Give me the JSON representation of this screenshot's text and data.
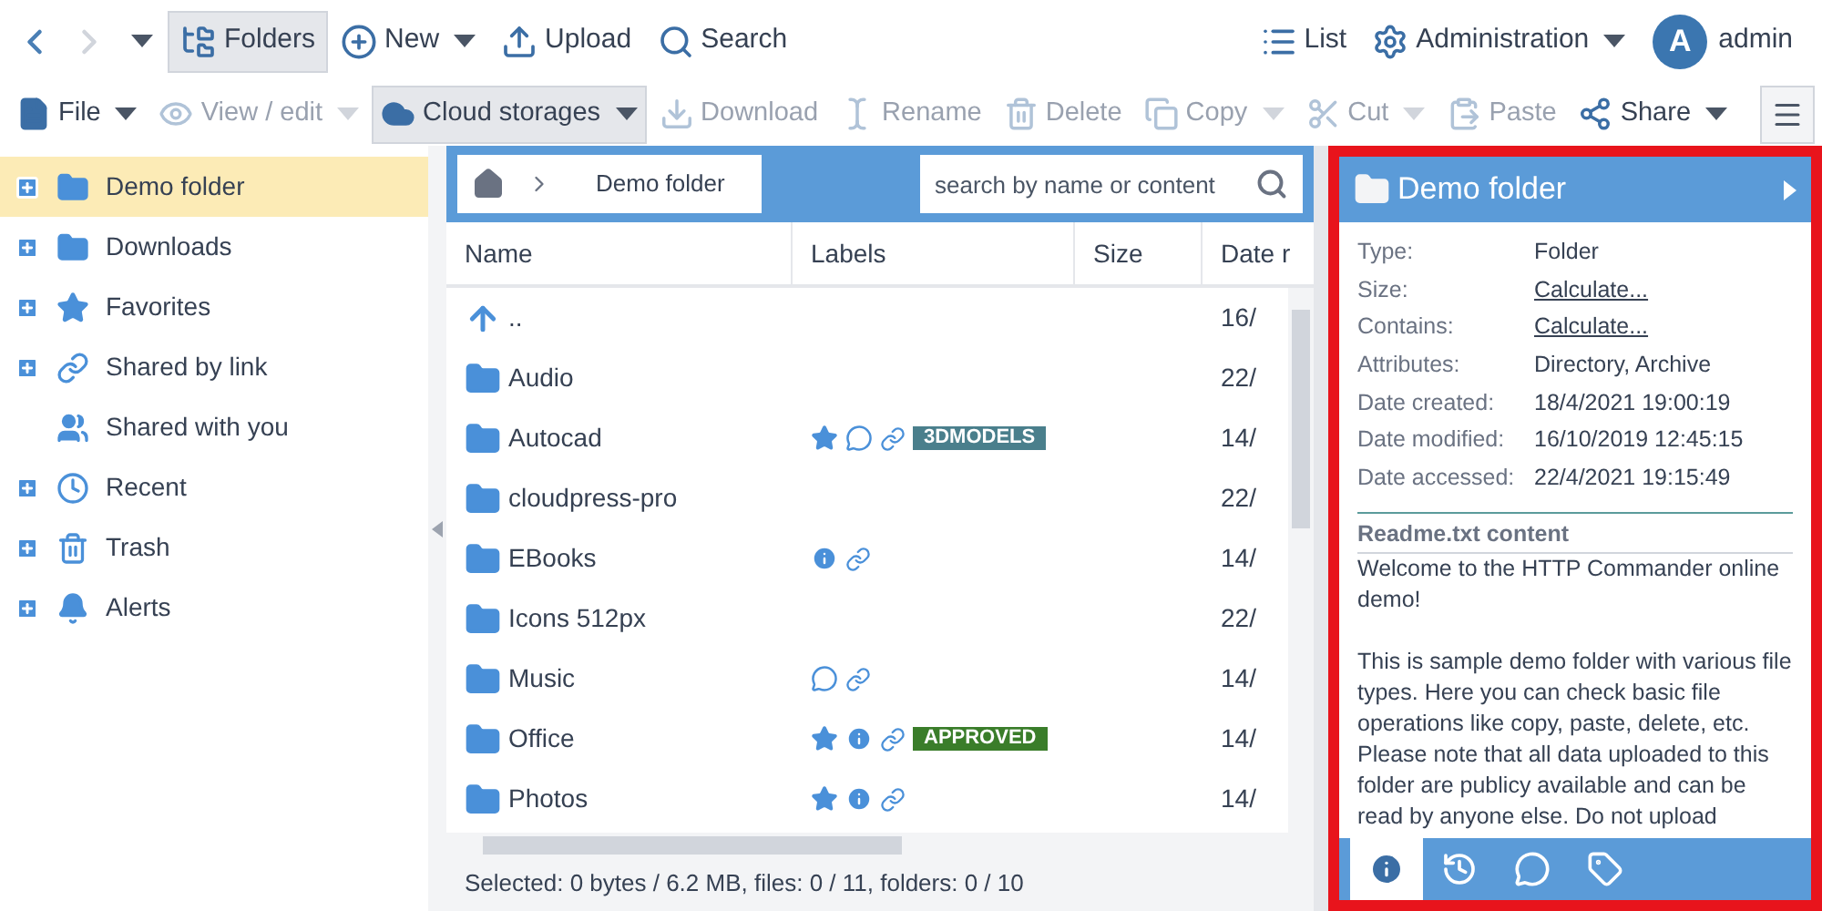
{
  "nav": [
    {
      "kind": "back",
      "disabled": false
    },
    {
      "kind": "forward",
      "disabled": true
    },
    {
      "kind": "history",
      "disabled": false
    }
  ],
  "toolbar_top": {
    "left": [
      {
        "label": "Folders",
        "selected": true,
        "dropdown": false
      },
      {
        "label": "New",
        "selected": false,
        "dropdown": true
      },
      {
        "label": "Upload",
        "selected": false,
        "dropdown": false
      },
      {
        "label": "Search",
        "selected": false,
        "dropdown": false
      }
    ],
    "right": [
      {
        "label": "List",
        "selected": false,
        "dropdown": false
      },
      {
        "label": "Administration",
        "selected": false,
        "dropdown": true
      }
    ],
    "user": {
      "initial": "A",
      "name": "admin"
    }
  },
  "toolbar": [
    {
      "label": "File",
      "dropdown": true,
      "disabled": false,
      "selected": false
    },
    {
      "label": "View / edit",
      "dropdown": true,
      "disabled": true,
      "selected": false
    },
    {
      "label": "Cloud storages",
      "dropdown": true,
      "disabled": false,
      "selected": true
    },
    {
      "label": "Download",
      "dropdown": false,
      "disabled": true,
      "selected": false
    },
    {
      "label": "Rename",
      "dropdown": false,
      "disabled": true,
      "selected": false
    },
    {
      "label": "Delete",
      "dropdown": false,
      "disabled": true,
      "selected": false
    },
    {
      "label": "Copy",
      "dropdown": true,
      "disabled": true,
      "selected": false
    },
    {
      "label": "Cut",
      "dropdown": true,
      "disabled": true,
      "selected": false
    },
    {
      "label": "Paste",
      "dropdown": false,
      "disabled": true,
      "selected": false
    },
    {
      "label": "Share",
      "dropdown": true,
      "disabled": false,
      "selected": false
    }
  ],
  "sidebar": {
    "items": [
      {
        "label": "Demo folder",
        "expandable": true,
        "selected": true
      },
      {
        "label": "Downloads",
        "expandable": true,
        "selected": false
      },
      {
        "label": "Favorites",
        "expandable": true,
        "selected": false
      },
      {
        "label": "Shared by link",
        "expandable": true,
        "selected": false
      },
      {
        "label": "Shared with you",
        "expandable": false,
        "selected": false
      },
      {
        "label": "Recent",
        "expandable": true,
        "selected": false
      },
      {
        "label": "Trash",
        "expandable": true,
        "selected": false
      },
      {
        "label": "Alerts",
        "expandable": true,
        "selected": false
      }
    ]
  },
  "breadcrumb": [
    "Demo folder"
  ],
  "search": {
    "placeholder": "search by name or content"
  },
  "table": {
    "columns": [
      "Name",
      "Labels",
      "Size",
      "Date r"
    ],
    "rows": [
      {
        "kind": "up",
        "name": "..",
        "labels": [],
        "date": "16/"
      },
      {
        "kind": "folder",
        "name": "Audio",
        "labels": [],
        "date": "22/"
      },
      {
        "kind": "folder",
        "name": "Autocad",
        "labels": [
          {
            "kind": "star"
          },
          {
            "kind": "comment"
          },
          {
            "kind": "link"
          },
          {
            "kind": "tag",
            "text": "3DMODELS",
            "color": "#4a7f8c"
          }
        ],
        "date": "14/"
      },
      {
        "kind": "folder",
        "name": "cloudpress-pro",
        "labels": [],
        "date": "22/"
      },
      {
        "kind": "folder",
        "name": "EBooks",
        "labels": [
          {
            "kind": "info"
          },
          {
            "kind": "link"
          }
        ],
        "date": "14/"
      },
      {
        "kind": "folder",
        "name": "Icons 512px",
        "labels": [],
        "date": "22/"
      },
      {
        "kind": "folder",
        "name": "Music",
        "labels": [
          {
            "kind": "comment"
          },
          {
            "kind": "link"
          }
        ],
        "date": "14/"
      },
      {
        "kind": "folder",
        "name": "Office",
        "labels": [
          {
            "kind": "star"
          },
          {
            "kind": "info"
          },
          {
            "kind": "link"
          },
          {
            "kind": "tag",
            "text": "APPROVED",
            "color": "#3a7d2a"
          }
        ],
        "date": "14/"
      },
      {
        "kind": "folder",
        "name": "Photos",
        "labels": [
          {
            "kind": "star"
          },
          {
            "kind": "info"
          },
          {
            "kind": "link"
          }
        ],
        "date": "14/"
      }
    ]
  },
  "status_bar": "Selected: 0 bytes / 6.2 MB, files: 0 / 11, folders: 0 / 10",
  "details": {
    "title": "Demo folder",
    "properties": [
      {
        "label": "Type:",
        "value": "Folder",
        "link": false
      },
      {
        "label": "Size:",
        "value": "Calculate...",
        "link": true
      },
      {
        "label": "Contains:",
        "value": "Calculate...",
        "link": true
      },
      {
        "label": "Attributes:",
        "value": "Directory, Archive",
        "link": false
      },
      {
        "label": "Date created:",
        "value": "18/4/2021 19:00:19",
        "link": false
      },
      {
        "label": "Date modified:",
        "value": "16/10/2019 12:45:15",
        "link": false
      },
      {
        "label": "Date accessed:",
        "value": "22/4/2021 19:15:49",
        "link": false
      }
    ],
    "readme_title": "Readme.txt content",
    "readme": "Welcome to the HTTP Commander online demo!\n\nThis is sample demo folder with various file types. Here you can check basic file operations like copy, paste, delete, etc. Please note that all data uploaded to this folder are publicy available and can be read by anyone else. Do not upload",
    "tabs": [
      {
        "selected": true
      },
      {
        "selected": false
      },
      {
        "selected": false
      },
      {
        "selected": false
      }
    ]
  }
}
